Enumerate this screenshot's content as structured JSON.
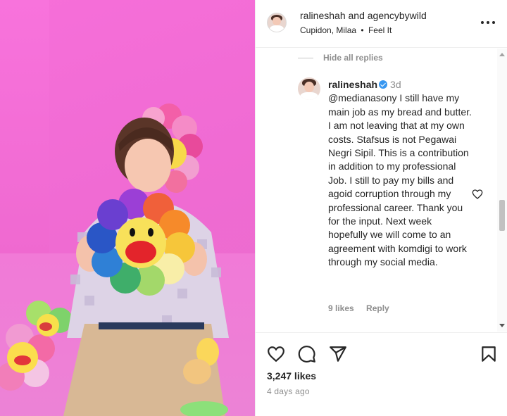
{
  "photo": {
    "alt": ""
  },
  "header": {
    "username": "ralineshah",
    "joiner": "and",
    "collaborator": "agencybywild",
    "location": "Cupidon, Milaa",
    "separator": "•",
    "audio": "Feel It"
  },
  "comments": {
    "hide_replies_label": "Hide all replies",
    "reply": {
      "username": "ralineshah",
      "time": "3d",
      "text": "@medianasony I still have my main job as my bread and butter. I am not leaving that at my own costs. Stafsus is not Pegawai Negri Sipil. This is a contribution in addition to my professional Job. I still to pay my bills and agoid corruption through my professional career. Thank you for the input. Next week hopefully we will come to an agreement with komdigi to work through my social media.",
      "likes": "9 likes",
      "reply_label": "Reply"
    }
  },
  "footer": {
    "likes": "3,247 likes",
    "posted": "4 days ago"
  },
  "icons": {
    "like": "heart-icon",
    "comment": "comment-icon",
    "share": "share-icon",
    "save": "bookmark-icon",
    "more": "more-options-icon",
    "verified": "verified-badge-icon"
  },
  "colors": {
    "text": "#262626",
    "muted": "#8e8e8e",
    "verified": "#3897f0",
    "photo_pink": "#f06bd3"
  }
}
